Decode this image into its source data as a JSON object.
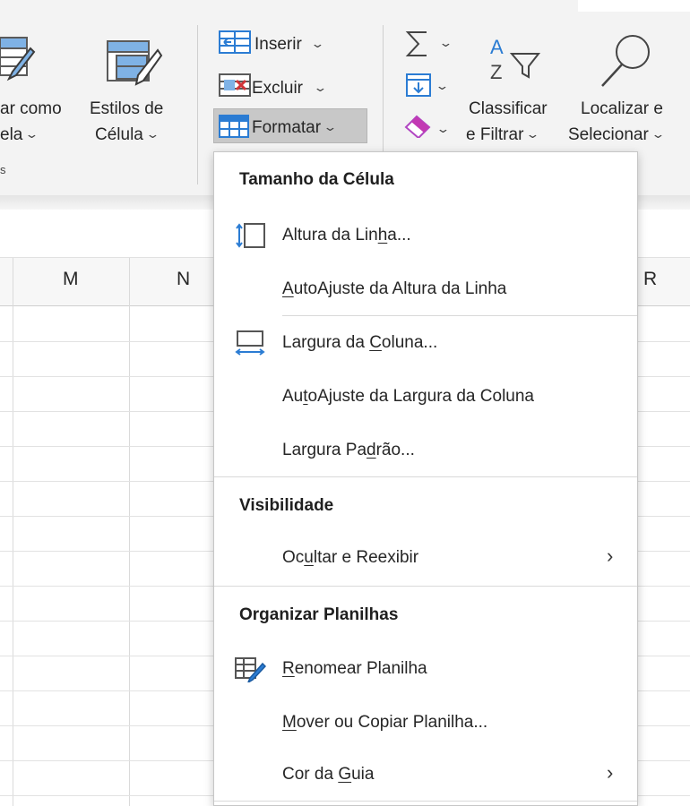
{
  "ribbon": {
    "format_table": {
      "line1": "ar como",
      "line2": "ela"
    },
    "cell_styles": {
      "line1": "Estilos de",
      "line2": "Célula"
    },
    "insert_label": "Inserir",
    "delete_label": "Excluir",
    "format_label": "Formatar",
    "sort_filter": {
      "line1": "Classificar",
      "line2": "e Filtrar"
    },
    "find_select": {
      "line1": "Localizar e",
      "line2": "Selecionar"
    },
    "group_fragment": "s",
    "chevron": "⌄",
    "icons": [
      "format-as-table-icon",
      "cell-styles-icon",
      "insert-cells-icon",
      "delete-cells-icon",
      "format-cells-icon",
      "autosum-icon",
      "fill-icon",
      "clear-icon",
      "sort-filter-icon",
      "find-select-icon"
    ]
  },
  "grid": {
    "columns": [
      "M",
      "N",
      "R"
    ]
  },
  "menu": {
    "section_cell_size": "Tamanho da Célula",
    "row_height": {
      "pre": "Altura da Lin",
      "ul": "h",
      "post": "a..."
    },
    "autofit_row": {
      "pre": "",
      "ul": "A",
      "post": "utoAjuste da Altura da Linha"
    },
    "column_width": {
      "pre": "Largura da ",
      "ul": "C",
      "post": "oluna..."
    },
    "autofit_column": {
      "pre": "Au",
      "ul": "t",
      "post": "oAjuste da Largura da Coluna"
    },
    "default_width": {
      "pre": "Largura Pa",
      "ul": "d",
      "post": "rão..."
    },
    "section_visibility": "Visibilidade",
    "hide_unhide": {
      "pre": "Oc",
      "ul": "u",
      "post": "ltar e Reexibir"
    },
    "section_organize": "Organizar Planilhas",
    "rename_sheet": {
      "pre": "",
      "ul": "R",
      "post": "enomear Planilha"
    },
    "move_copy": {
      "pre": "",
      "ul": "M",
      "post": "over ou Copiar Planilha..."
    },
    "tab_color": {
      "pre": "Cor da ",
      "ul": "G",
      "post": "uia"
    },
    "submenu_arrow": "›",
    "accent_color": "#2b7cd3"
  }
}
